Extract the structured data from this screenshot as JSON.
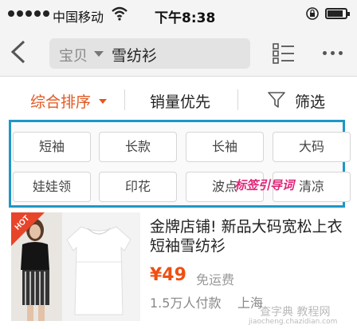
{
  "status_bar": {
    "carrier": "中国移动",
    "time": "下午8:38",
    "battery_level": 0.85,
    "icons": [
      "signal-dots",
      "wifi-icon",
      "lock-rotation-icon",
      "battery-icon"
    ]
  },
  "nav": {
    "search_scope": "宝贝",
    "search_query": "雪纺衫",
    "icons": [
      "back-chevron-icon",
      "list-view-icon",
      "more-dots-icon"
    ]
  },
  "sort": {
    "default_label": "综合排序",
    "sales_label": "销量优先",
    "filter_label": "筛选",
    "active_color": "#e3571f",
    "icons": [
      "caret-down-icon",
      "funnel-icon"
    ]
  },
  "tags": {
    "row1": [
      "短袖",
      "长款",
      "长袖",
      "大码"
    ],
    "row2": [
      "娃娃领",
      "印花",
      "波点",
      "清凉"
    ],
    "annotation": "标签引导词",
    "border_color": "#1e97c8"
  },
  "product": {
    "badge": "HOT",
    "title": "金牌店铺! 新品大码宽松上衣短袖雪纺衫",
    "price": "¥49",
    "shipping": "免运费",
    "buyers": "1.5万人付款",
    "location": "上海",
    "price_color": "#ee4f13"
  },
  "watermark": {
    "text": "查字典 教程网",
    "sub": "jiaocheng.chazidian.com"
  }
}
